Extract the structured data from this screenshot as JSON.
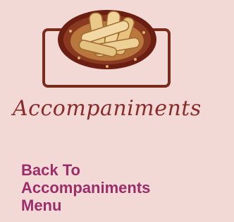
{
  "header": {
    "image_icon": "rolled-wafers-plate-icon",
    "title": "Accompaniments"
  },
  "nav": {
    "back_link": {
      "line1": "Back To",
      "line2": "Accompaniments",
      "line3": "Menu"
    }
  },
  "colors": {
    "background": "#f2d9d5",
    "title": "#8a2c2c",
    "link": "#9c2d6b",
    "frame": "#7a2c1c"
  }
}
